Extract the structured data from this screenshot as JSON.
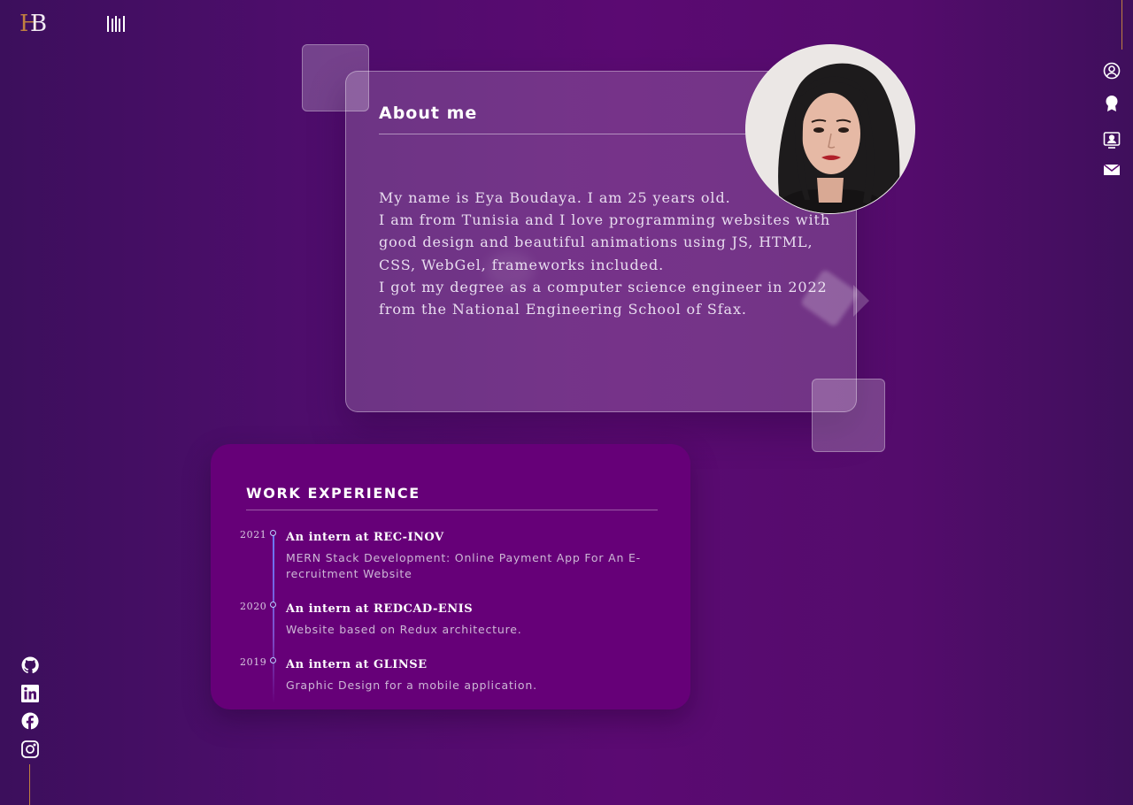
{
  "brand": {
    "logo_h": "H",
    "logo_b": "B"
  },
  "about": {
    "title": "About me",
    "lines": [
      "My name is Eya Boudaya. I am 25 years old.",
      "I am from Tunisia and I love programming websites with",
      "good design and beautiful animations using JS, HTML,",
      "CSS, WebGel, frameworks included.",
      "I got my degree as a computer science engineer in 2022",
      "from the National Engineering School of Sfax."
    ]
  },
  "work": {
    "title": "WORK EXPERIENCE",
    "jobs": [
      {
        "year": "2021",
        "role": "An intern at REC-INOV",
        "desc_lines": [
          "MERN Stack Development: Online Payment App For An E-",
          "recruitment Website"
        ]
      },
      {
        "year": "2020",
        "role": "An intern at REDCAD-ENIS",
        "desc_lines": [
          "Website based on Redux architecture."
        ]
      },
      {
        "year": "2019",
        "role": "An intern at GLINSE",
        "desc_lines": [
          "Graphic Design for a mobile application."
        ]
      }
    ]
  },
  "right_nav": [
    "user-icon",
    "award-icon",
    "portfolio-icon",
    "mail-icon"
  ],
  "social": [
    "github-icon",
    "linkedin-icon",
    "facebook-icon",
    "instagram-icon"
  ],
  "colors": {
    "accent": "#c08040",
    "work_bg": "#660078",
    "timeline": "#6a7cff"
  }
}
